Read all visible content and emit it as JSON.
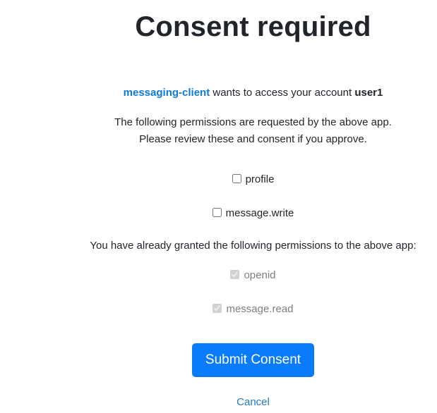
{
  "title": "Consent required",
  "request": {
    "client_id": "messaging-client",
    "middle_text": " wants to access your account ",
    "username": "user1"
  },
  "info": {
    "line1": "The following permissions are requested by the above app.",
    "line2": "Please review these and consent if you approve."
  },
  "requested_scopes": [
    {
      "label": "profile",
      "checked": false
    },
    {
      "label": "message.write",
      "checked": false
    }
  ],
  "already_granted_text": "You have already granted the following permissions to the above app:",
  "granted_scopes": [
    {
      "label": "openid",
      "checked": true
    },
    {
      "label": "message.read",
      "checked": true
    }
  ],
  "actions": {
    "submit_label": "Submit Consent",
    "cancel_label": "Cancel"
  }
}
